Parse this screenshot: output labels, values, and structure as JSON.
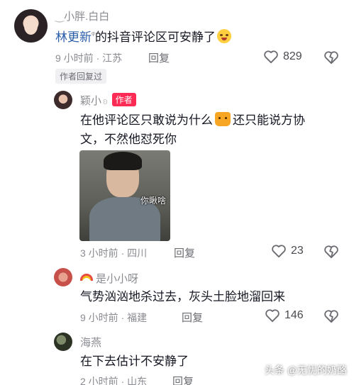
{
  "comments": [
    {
      "username": "小胖.白白",
      "mention": "林更新",
      "text": "的抖音评论区可安静了",
      "time": "9 小时前 · 江苏",
      "reply_label": "回复",
      "likes": "829",
      "badge": "作者回复过"
    },
    {
      "username": "颖小",
      "author_badge": "作者",
      "text_line1a": "在他评论区只敢说为什么",
      "text_line1b": "还只能说方协",
      "text_line2": "文，不然他怼死你",
      "sticker_caption": "你瞅啥",
      "time": "3 小时前 · 四川",
      "reply_label": "回复",
      "likes": "23"
    },
    {
      "username": "是小小呀",
      "text": "气势汹汹地杀过去，灰头土脸地溜回来",
      "time": "9 小时前 · 福建",
      "reply_label": "回复",
      "likes": "146"
    },
    {
      "username": "海燕",
      "text": "在下去估计不安静了",
      "time": "2 小时前 · 山东",
      "reply_label": "回复"
    }
  ],
  "watermark": "头条 @无忧的奶酪",
  "icons": {
    "like": "heart-outline-icon",
    "dislike": "broken-heart-icon"
  }
}
